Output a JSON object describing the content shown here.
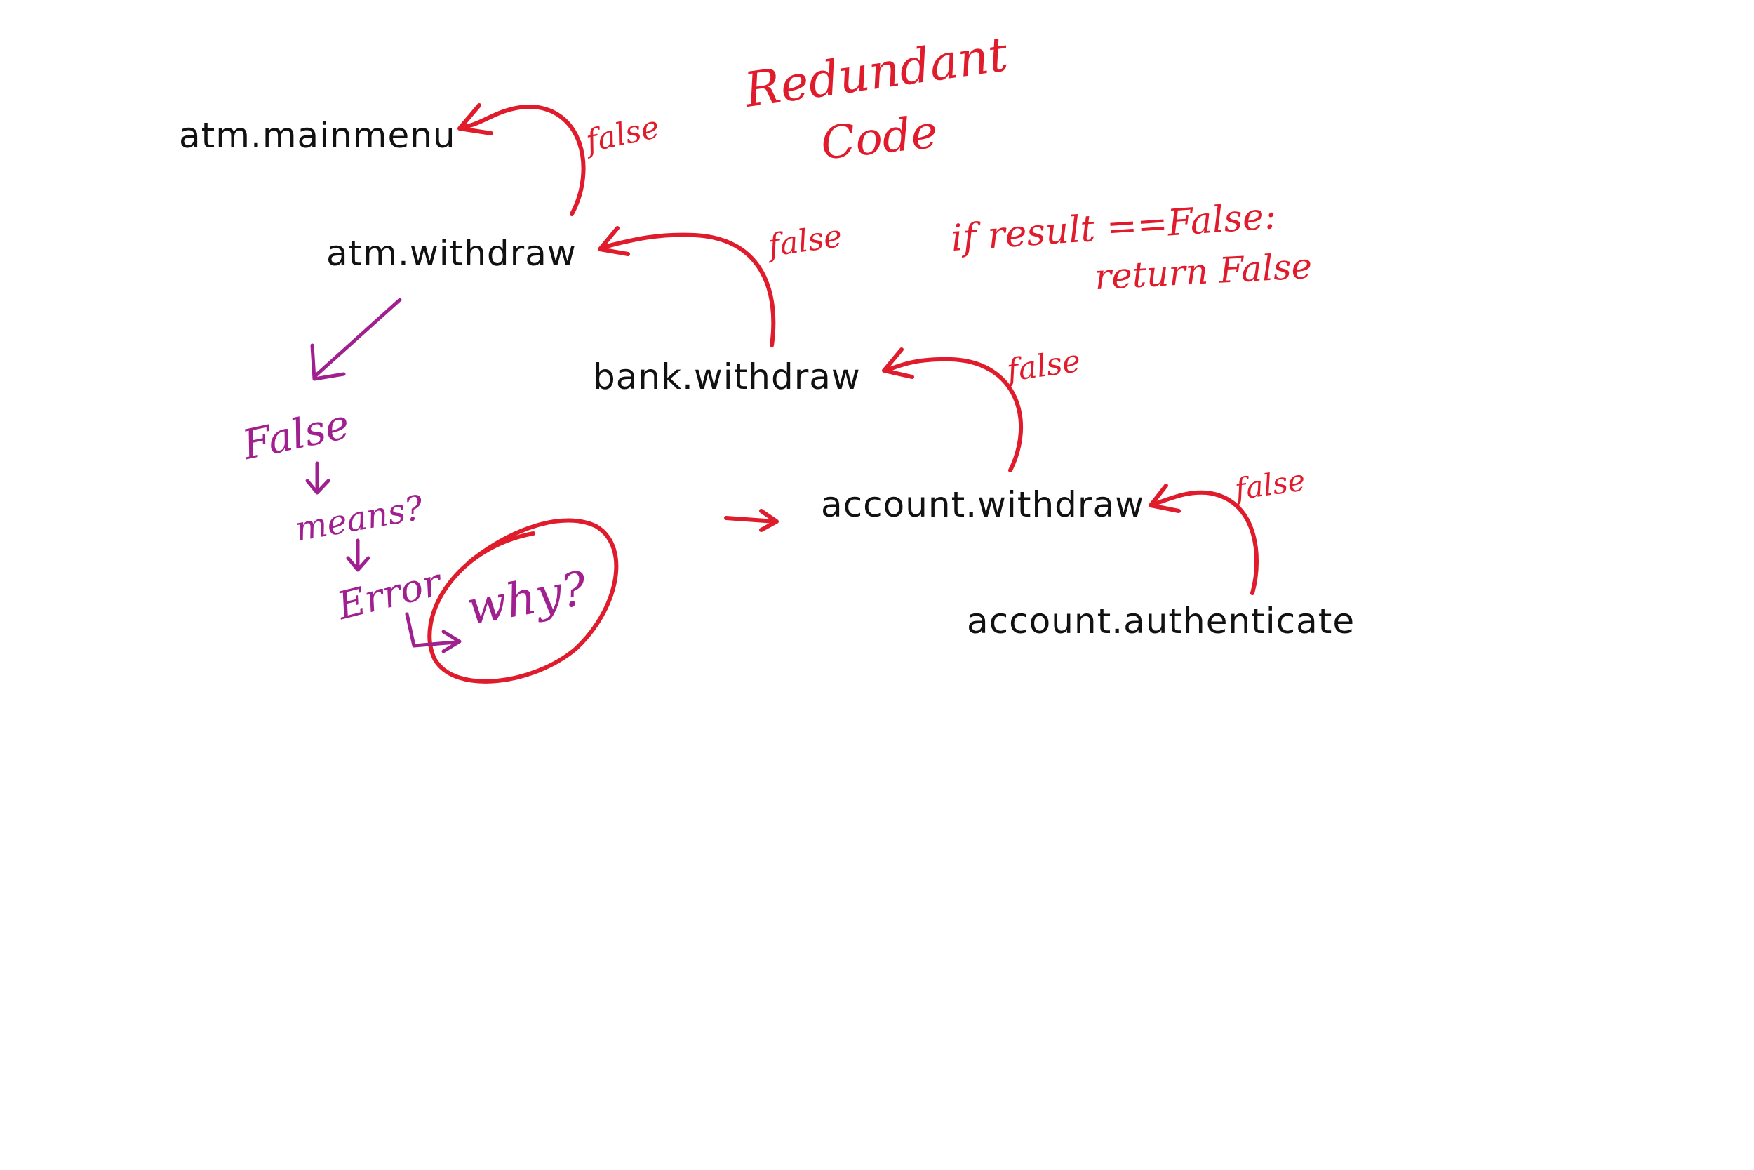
{
  "colors": {
    "node_text": "#111111",
    "annotation_red": "#e01b2b",
    "annotation_purple": "#a0208f"
  },
  "nodes": {
    "atm_mainmenu": "atm.mainmenu",
    "atm_withdraw": "atm.withdraw",
    "bank_withdraw": "bank.withdraw",
    "account_withdraw": "account.withdraw",
    "account_authenticate": "account.authenticate"
  },
  "edge_labels": {
    "withdraw_to_mainmenu": "false",
    "bank_to_atm": "false",
    "account_to_bank": "false",
    "authenticate_to_account": "false"
  },
  "notes": {
    "redundant_line1": "Redundant",
    "redundant_line2": "Code",
    "code_line1": "if result ==False:",
    "code_line2": "return False",
    "false_word": "False",
    "means": "means?",
    "error": "Error",
    "why": "why?"
  }
}
